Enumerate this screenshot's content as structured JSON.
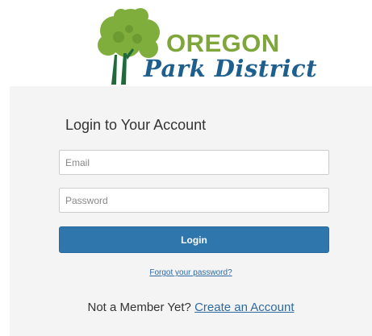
{
  "logo": {
    "word1": "OREGON",
    "word2": "Park District",
    "icon": "tree-icon",
    "colors": {
      "green": "#7fa63a",
      "blue": "#1e5f8e"
    }
  },
  "login": {
    "title": "Login to Your Account",
    "email_placeholder": "Email",
    "password_placeholder": "Password",
    "submit_label": "Login",
    "forgot_link": "Forgot your password?",
    "signup_prompt": "Not a Member Yet?",
    "signup_link": "Create an Account"
  },
  "colors": {
    "button": "#2f76ad",
    "link": "#2f6aa2",
    "panel_bg": "#f4f4f4"
  }
}
